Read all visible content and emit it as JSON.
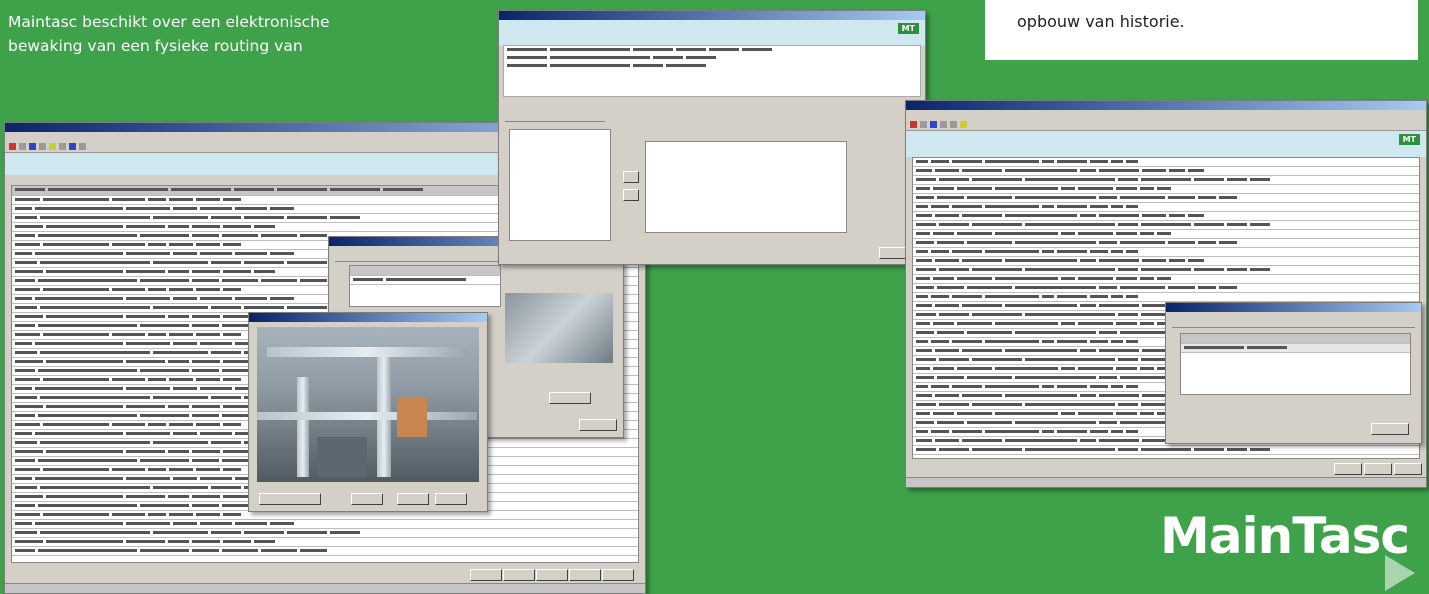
{
  "intro": {
    "line1": "Maintasc beschikt over een elektronische",
    "line2": "bewaking van een fysieke routing van"
  },
  "note_box": {
    "text": "opbouw van historie."
  },
  "logo": {
    "text": "MainTasc"
  },
  "colors": {
    "background": "#3ea24a",
    "window": "#d4d0c8",
    "title_gradient": "#0a246a"
  }
}
